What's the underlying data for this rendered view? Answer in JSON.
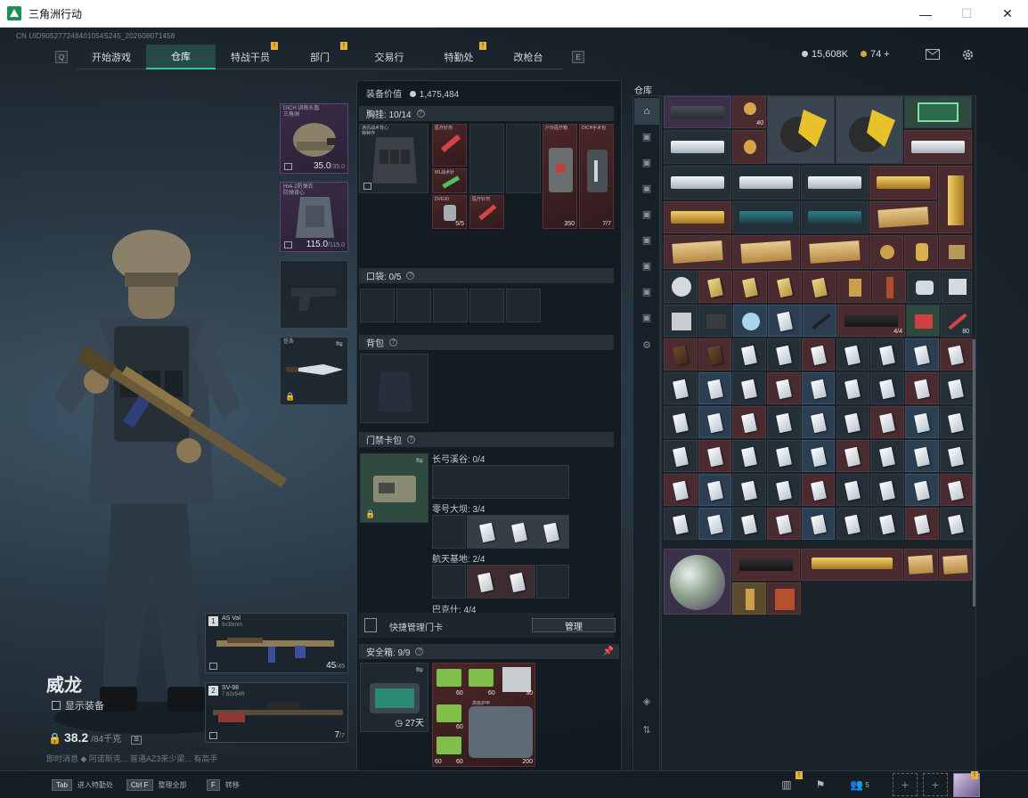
{
  "window": {
    "title": "三角洲行动",
    "min": "—",
    "max": "☐",
    "close": "✕"
  },
  "uid": "CN UID905277248401054S245_202608071458",
  "nav": {
    "left_key": "Q",
    "right_key": "E",
    "tabs": [
      {
        "label": "开始游戏",
        "active": false,
        "alert": false
      },
      {
        "label": "仓库",
        "active": true,
        "alert": false
      },
      {
        "label": "特战干员",
        "active": false,
        "alert": true
      },
      {
        "label": "部门",
        "active": false,
        "alert": true
      },
      {
        "label": "交易行",
        "active": false,
        "alert": false
      },
      {
        "label": "特勤处",
        "active": false,
        "alert": true
      },
      {
        "label": "改枪台",
        "active": false,
        "alert": false
      }
    ],
    "alert_mark": "!"
  },
  "currency": {
    "silver": "15,608K",
    "gold": "74",
    "plus": "+"
  },
  "agent": {
    "name": "威龙",
    "show_equipment": "显示装备",
    "weight": "38.2",
    "weight_max": "/84千克"
  },
  "ticker": "即时消息 ◆ 阿诺斯克... 普通AZ3来少梁... 有高手",
  "equip_slots": {
    "helmet": {
      "label": "DICH 训练头盔\n三角洲",
      "dur": "35.0",
      "dur_max": "/35.0"
    },
    "armor": {
      "label": "Hvk-2防弹衣\n防弹背心",
      "dur": "115.0",
      "dur_max": "/115.0"
    },
    "melee": {
      "label": "信条"
    }
  },
  "center": {
    "value_label": "装备价值",
    "value": "1,475,484",
    "rig_label": "胸挂: 10/14",
    "pocket_label": "口袋: 0/5",
    "backpack_label": "背包",
    "keycard_label": "门禁卡包",
    "key_groups": [
      {
        "label": "长弓溪谷: 0/4"
      },
      {
        "label": "零号大坝: 3/4"
      },
      {
        "label": "航天基地: 2/4"
      },
      {
        "label": "巴克什: 4/4"
      }
    ],
    "quick_manage": "快捷管理门卡",
    "manage_btn": "管理",
    "safebox_label": "安全箱: 9/9",
    "safebox_time": "27天",
    "rig_items": [
      {
        "label": "通讯战术背心\n特种作",
        "count": ""
      },
      {
        "label": "医疗针剂",
        "count": ""
      },
      {
        "label": "M1战术针",
        "count": ""
      },
      {
        "label": "DVE90",
        "count": "5/5"
      },
      {
        "label": "医疗针剂",
        "count": ""
      },
      {
        "label": "户外医疗箱",
        "count": "350"
      },
      {
        "label": "DICH手术包",
        "count": "7/7"
      }
    ],
    "safebox_counts": [
      "60",
      "60",
      "30",
      "60",
      "60",
      "60",
      "200"
    ],
    "safebox_item_label": "高级护甲"
  },
  "warehouse": {
    "title": "仓库",
    "counts": [
      "40",
      "4/4",
      "80"
    ]
  },
  "weapons": [
    {
      "slot": "1",
      "name": "AS Val",
      "caliber": "9x39mm",
      "ammo": "45",
      "ammo_max": "/45"
    },
    {
      "slot": "2",
      "name": "SV-98",
      "caliber": "7.62x54R",
      "ammo": "7",
      "ammo_max": "/7"
    }
  ],
  "bottom": {
    "hints": [
      {
        "key": "Tab",
        "text": "进入特勤处"
      },
      {
        "key": "Ctrl F",
        "text": "整理全部"
      },
      {
        "key": "F",
        "text": "转移"
      }
    ],
    "friends_count": "5"
  }
}
